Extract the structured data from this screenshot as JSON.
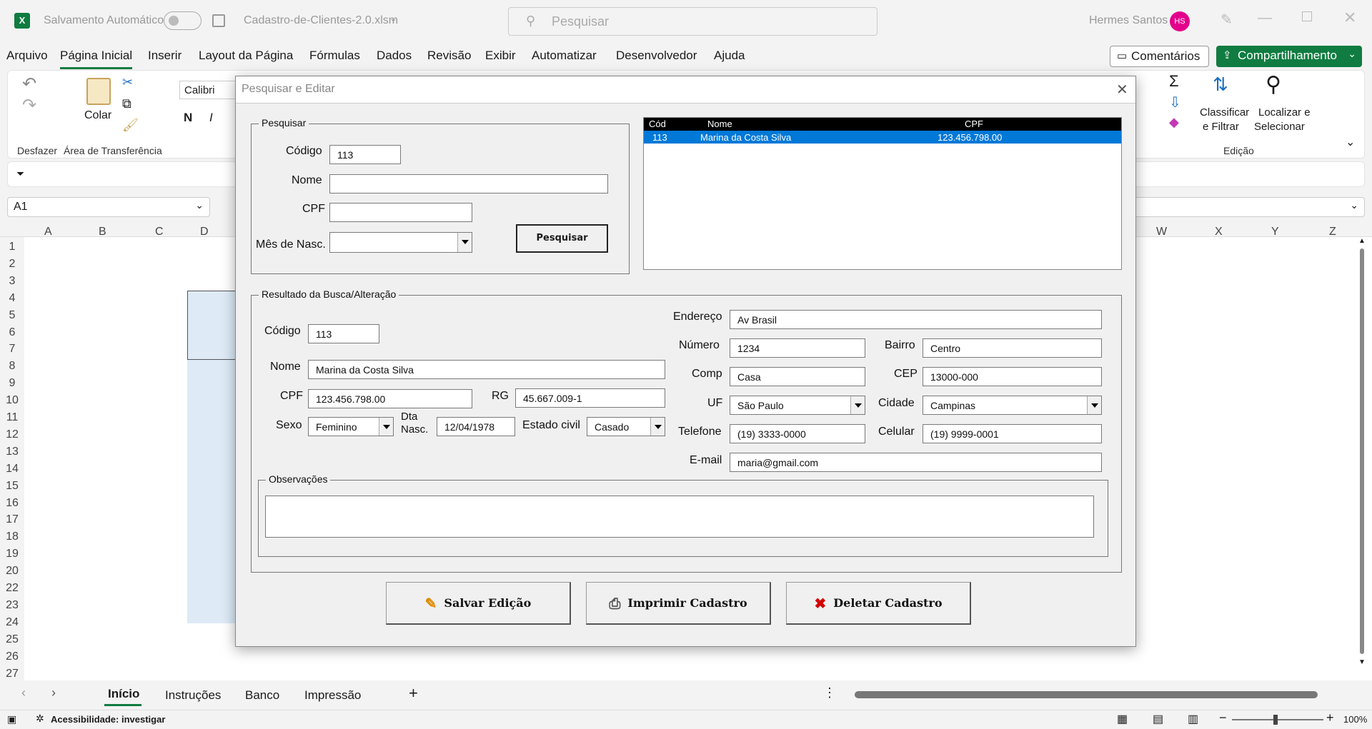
{
  "titlebar": {
    "autosave_label": "Salvamento Automático",
    "filename": "Cadastro-de-Clientes-2.0.xlsm",
    "search_placeholder": "Pesquisar",
    "user_name": "Hermes Santos",
    "user_initials": "HS"
  },
  "menu": {
    "items": [
      "Arquivo",
      "Página Inicial",
      "Inserir",
      "Layout da Página",
      "Fórmulas",
      "Dados",
      "Revisão",
      "Exibir",
      "Automatizar",
      "Desenvolvedor",
      "Ajuda"
    ],
    "comments": "Comentários",
    "share": "Compartilhamento"
  },
  "ribbon": {
    "undo_group": "Desfazer",
    "paste": "Colar",
    "clipboard_group": "Área de Transferência",
    "font": "Calibri",
    "bold": "N",
    "italic": "I",
    "sort_filter_1": "Classificar",
    "sort_filter_2": "e Filtrar",
    "find_select_1": "Localizar e",
    "find_select_2": "Selecionar",
    "editing_group": "Edição"
  },
  "formula": {
    "namebox": "A1"
  },
  "grid": {
    "columns_left": [
      "A",
      "B",
      "C",
      "D"
    ],
    "columns_right": [
      "W",
      "X",
      "Y",
      "Z"
    ],
    "rows": [
      "1",
      "2",
      "3",
      "4",
      "5",
      "6",
      "7",
      "8",
      "9",
      "10",
      "11",
      "12",
      "13",
      "14",
      "15",
      "16",
      "17",
      "18",
      "19",
      "20",
      "22",
      "23",
      "24",
      "25",
      "26",
      "27"
    ]
  },
  "sheets": {
    "tabs": [
      "Início",
      "Instruções",
      "Banco",
      "Impressão"
    ],
    "active": "Início"
  },
  "status": {
    "accessibility": "Acessibilidade: investigar",
    "zoom": "100%"
  },
  "dialog": {
    "title": "Pesquisar e Editar",
    "search": {
      "legend": "Pesquisar",
      "codigo_label": "Código",
      "codigo_value": "113",
      "nome_label": "Nome",
      "nome_value": "",
      "cpf_label": "CPF",
      "cpf_value": "",
      "mes_label": "Mês de Nasc.",
      "mes_value": "",
      "button": "Pesquisar"
    },
    "results": {
      "headers": [
        "Cód",
        "Nome",
        "CPF"
      ],
      "rows": [
        [
          "113",
          "Marina da Costa Silva",
          "123.456.798.00"
        ]
      ]
    },
    "record": {
      "legend": "Resultado da Busca/Alteração",
      "codigo_label": "Código",
      "codigo": "113",
      "nome_label": "Nome",
      "nome": "Marina da Costa Silva",
      "cpf_label": "CPF",
      "cpf": "123.456.798.00",
      "rg_label": "RG",
      "rg": "45.667.009-1",
      "sexo_label": "Sexo",
      "sexo": "Feminino",
      "dta_label_1": "Dta",
      "dta_label_2": "Nasc.",
      "dta": "12/04/1978",
      "estado_label": "Estado civil",
      "estado": "Casado",
      "endereco_label": "Endereço",
      "endereco": "Av Brasil",
      "numero_label": "Número",
      "numero": "1234",
      "bairro_label": "Bairro",
      "bairro": "Centro",
      "comp_label": "Comp",
      "comp": "Casa",
      "cep_label": "CEP",
      "cep": "13000-000",
      "uf_label": "UF",
      "uf": "São Paulo",
      "cidade_label": "Cidade",
      "cidade": "Campinas",
      "telefone_label": "Telefone",
      "telefone": "(19) 3333-0000",
      "celular_label": "Celular",
      "celular": "(19) 9999-0001",
      "email_label": "E-mail",
      "email": "maria@gmail.com",
      "obs_legend": "Observações",
      "obs": ""
    },
    "buttons": {
      "save": "Salvar Edição",
      "print": "Imprimir Cadastro",
      "delete": "Deletar Cadastro"
    }
  },
  "colors": {
    "excel_green": "#107c41",
    "selection_blue": "#0078d7",
    "avatar": "#e3008c"
  }
}
